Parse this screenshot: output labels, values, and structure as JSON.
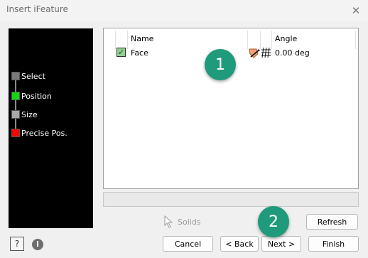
{
  "window": {
    "title": "Insert iFeature",
    "close_glyph": "✕"
  },
  "steps": [
    {
      "label": "Select",
      "color": "#7a7a7a"
    },
    {
      "label": "Position",
      "color": "#12d912"
    },
    {
      "label": "Size",
      "color": "#a8a8a8"
    },
    {
      "label": "Precise Pos.",
      "color": "#ff0000"
    }
  ],
  "table": {
    "columns": [
      "Name",
      "Angle"
    ],
    "rows": [
      {
        "checked": true,
        "name": "Face",
        "angle": "0.00 deg"
      }
    ]
  },
  "solids": {
    "label": "Solids"
  },
  "buttons": {
    "refresh": "Refresh",
    "cancel": "Cancel",
    "back": "< Back",
    "next": "Next >",
    "finish": "Finish",
    "help": "?",
    "info": "i"
  },
  "callouts": [
    "1",
    "2"
  ],
  "colors": {
    "callout": "#1f9a7a",
    "step_panel_bg": "#000000"
  }
}
